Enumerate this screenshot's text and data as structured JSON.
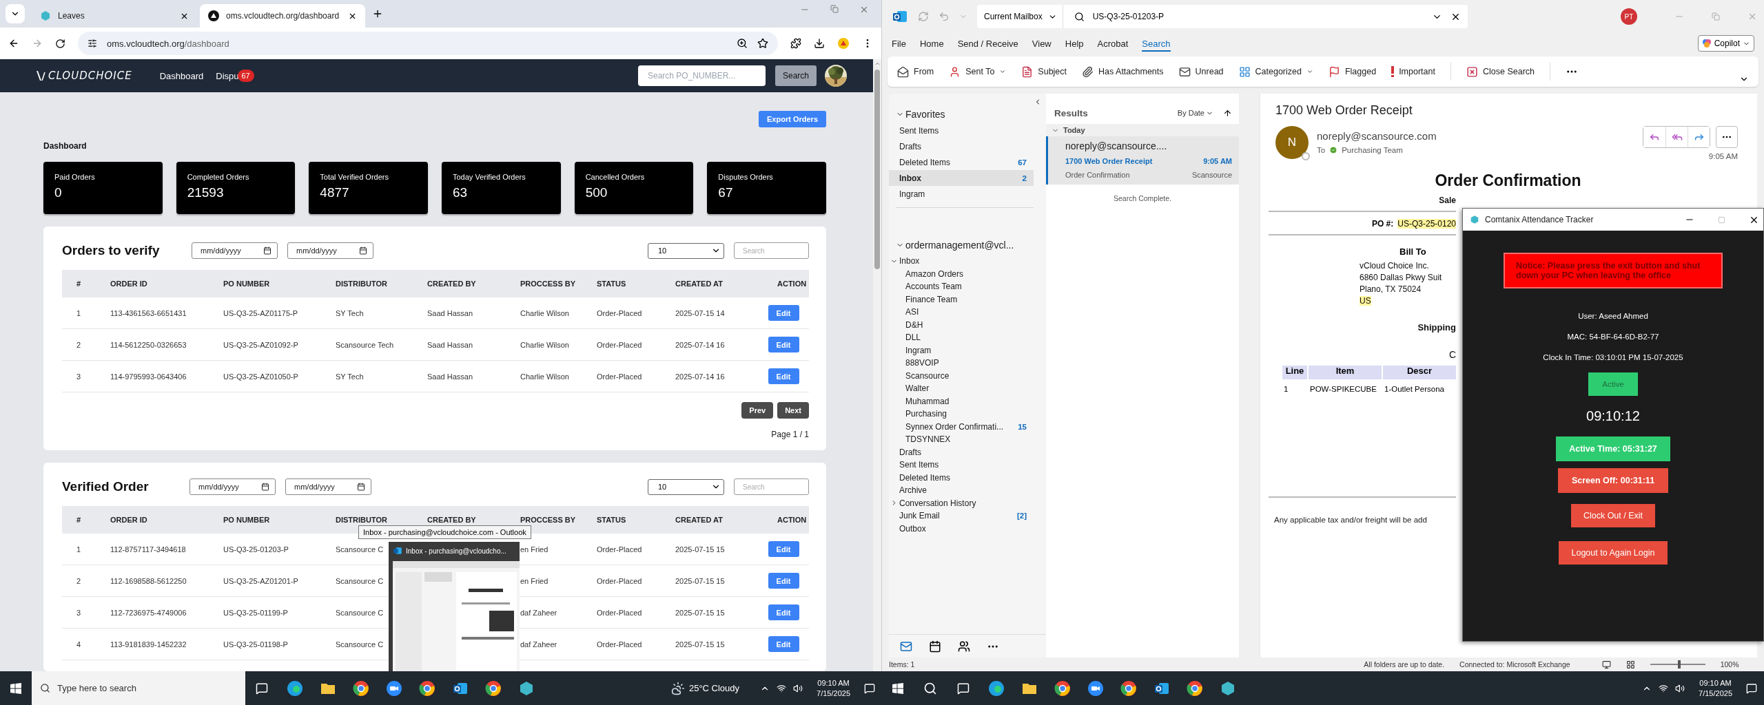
{
  "browser": {
    "tabs": [
      {
        "label": "Leaves",
        "selected": false
      },
      {
        "label": "oms.vcloudtech.org/dashboard",
        "selected": true
      }
    ],
    "address": {
      "host": "oms.vcloudtech.org",
      "path": "/dashboard"
    }
  },
  "site": {
    "logo": "CLOUDCHOICE",
    "nav": [
      {
        "label": "Dashboard"
      },
      {
        "label": "Dispu",
        "badge": "67"
      }
    ],
    "search": {
      "placeholder": "Search PO_NUMBER..."
    },
    "search_button": "Search"
  },
  "dashboard": {
    "export_button": "Export Orders",
    "title": "Dashboard",
    "stats": [
      {
        "label": "Paid Orders",
        "value": "0"
      },
      {
        "label": "Completed Orders",
        "value": "21593"
      },
      {
        "label": "Total Verified Orders",
        "value": "4877"
      },
      {
        "label": "Today Verified Orders",
        "value": "63"
      },
      {
        "label": "Cancelled Orders",
        "value": "500"
      },
      {
        "label": "Disputes Orders",
        "value": "67"
      }
    ]
  },
  "tables": [
    {
      "title": "Orders to verify",
      "date_filters": [
        "mm/dd/yyyy",
        "mm/dd/yyyy"
      ],
      "page_size": "10",
      "search": {
        "placeholder": "Search"
      },
      "columns": [
        "#",
        "ORDER ID",
        "PO NUMBER",
        "DISTRIBUTOR",
        "CREATED BY",
        "PROCCESS BY",
        "STATUS",
        "CREATED AT",
        "ACTION"
      ],
      "rows": [
        {
          "num": "1",
          "order_id": "113-4361563-6651431",
          "po": "US-Q3-25-AZ01175-P",
          "distributor": "SY Tech",
          "created_by": "Saad Hassan",
          "process_by": "Charlie Wilson",
          "status": "Order-Placed",
          "created_at": "2025-07-15 14",
          "action": "Edit"
        },
        {
          "num": "2",
          "order_id": "114-5612250-0326653",
          "po": "US-Q3-25-AZ01092-P",
          "distributor": "Scansource Tech",
          "created_by": "Saad Hassan",
          "process_by": "Charlie Wilson",
          "status": "Order-Placed",
          "created_at": "2025-07-14 16",
          "action": "Edit"
        },
        {
          "num": "3",
          "order_id": "114-9795993-0643406",
          "po": "US-Q3-25-AZ01050-P",
          "distributor": "SY Tech",
          "created_by": "Saad Hassan",
          "process_by": "Charlie Wilson",
          "status": "Order-Placed",
          "created_at": "2025-07-14 16",
          "action": "Edit"
        }
      ],
      "pager": {
        "prev": "Prev",
        "next": "Next",
        "page": "Page 1 / 1"
      }
    },
    {
      "title": "Verified Order",
      "date_filters": [
        "mm/dd/yyyy",
        "mm/dd/yyyy"
      ],
      "page_size": "10",
      "search": {
        "placeholder": "Search"
      },
      "columns": [
        "#",
        "ORDER ID",
        "PO NUMBER",
        "DISTRIBUTOR",
        "CREATED BY",
        "PROCCESS BY",
        "STATUS",
        "CREATED AT",
        "ACTION"
      ],
      "rows": [
        {
          "num": "1",
          "order_id": "112-8757117-3494618",
          "po": "US-Q3-25-01203-P",
          "distributor": "Scansource C",
          "process_by": "en Fried",
          "status": "Order-Placed",
          "created_at": "2025-07-15 15",
          "action": "Edit"
        },
        {
          "num": "2",
          "order_id": "112-1698588-5612250",
          "po": "US-Q3-25-AZ01201-P",
          "distributor": "Scansource C",
          "process_by": "en Fried",
          "status": "Order-Placed",
          "created_at": "2025-07-15 15",
          "action": "Edit"
        },
        {
          "num": "3",
          "order_id": "112-7236975-4749006",
          "po": "US-Q3-25-01199-P",
          "distributor": "Scansource C",
          "process_by": "daf Zaheer",
          "status": "Order-Placed",
          "created_at": "2025-07-15 15",
          "action": "Edit"
        },
        {
          "num": "4",
          "order_id": "113-9181839-1452232",
          "po": "US-Q3-25-01198-P",
          "distributor": "Scansource C",
          "process_by": "daf Zaheer",
          "status": "Order-Placed",
          "created_at": "2025-07-15 15",
          "action": "Edit"
        }
      ]
    }
  ],
  "task_preview": {
    "tooltip": "Inbox - purchasing@vcloudchoice.com - Outlook",
    "title": "Inbox - purchasing@vcloudcho..."
  },
  "outlook": {
    "scope": "Current Mailbox",
    "search_value": "US-Q3-25-01203-P",
    "account_initials": "PT",
    "menu": [
      {
        "label": "File",
        "selected": false
      },
      {
        "label": "Home",
        "selected": false
      },
      {
        "label": "Send / Receive",
        "selected": false
      },
      {
        "label": "View",
        "selected": false
      },
      {
        "label": "Help",
        "selected": false
      },
      {
        "label": "Acrobat",
        "selected": false
      },
      {
        "label": "Search",
        "selected": true
      }
    ],
    "copilot": "Copilot",
    "ribbon": [
      {
        "label": "From"
      },
      {
        "label": "Sent To",
        "dropdown": true
      },
      {
        "label": "Subject"
      },
      {
        "label": "Has Attachments"
      },
      {
        "label": "Unread"
      },
      {
        "label": "Categorized",
        "dropdown": true
      },
      {
        "label": "Flagged"
      },
      {
        "label": "Important"
      },
      {
        "label": "Close Search"
      }
    ],
    "favorites": {
      "label": "Favorites",
      "expanded": true,
      "items": [
        {
          "label": "Sent Items",
          "selected": false
        },
        {
          "label": "Drafts",
          "selected": false
        },
        {
          "label": "Deleted Items",
          "count": "67",
          "selected": false
        },
        {
          "label": "Inbox",
          "count": "2",
          "selected": true
        },
        {
          "label": "Ingram",
          "selected": false
        }
      ]
    },
    "account": {
      "label": "ordermanagement@vcl...",
      "expanded": true,
      "children": [
        {
          "label": "Inbox",
          "expanded": true,
          "children": [
            {
              "label": "Amazon Orders"
            },
            {
              "label": "Accounts Team"
            },
            {
              "label": "Finance Team"
            },
            {
              "label": "ASI"
            },
            {
              "label": "D&H"
            },
            {
              "label": "DLL"
            },
            {
              "label": "Ingram"
            },
            {
              "label": "888VOIP"
            },
            {
              "label": "Scansource"
            },
            {
              "label": "Walter"
            },
            {
              "label": "Muhammad"
            },
            {
              "label": "Purchasing"
            },
            {
              "label": "Synnex Order Confirmati...",
              "count": "15"
            },
            {
              "label": "TDSYNNEX"
            }
          ]
        },
        {
          "label": "Drafts"
        },
        {
          "label": "Sent Items"
        },
        {
          "label": "Deleted Items"
        },
        {
          "label": "Archive"
        },
        {
          "label": "Conversation History",
          "expanded": false
        },
        {
          "label": "Junk Email",
          "count": "[2]"
        },
        {
          "label": "Outbox"
        }
      ]
    },
    "results": {
      "title": "Results",
      "sort": "By Date",
      "group": "Today",
      "messages": [
        {
          "sender": "noreply@scansource....",
          "subject": "1700 Web Order Receipt",
          "time": "9:05 AM",
          "preview": "Order Confirmation",
          "folder": "Scansource",
          "selected": true
        }
      ],
      "status": "Search Complete."
    },
    "reading": {
      "subject": "1700 Web Order Receipt",
      "avatar_initial": "N",
      "from": "noreply@scansource.com",
      "to_label": "To",
      "to": "Purchasing Team",
      "time": "9:05 AM",
      "heading": "Order Confirmation",
      "sale": "Sale",
      "po_label": "PO #:",
      "po_value": "US-Q3-25-0120",
      "bill_to": "Bill To",
      "address": [
        "vCloud Choice Inc.",
        "6860 Dallas Pkwy Suit",
        "Plano, TX 75024",
        "US"
      ],
      "shipping": "Shipping",
      "c": "C",
      "items_columns": [
        "Line",
        "Item",
        "Descr"
      ],
      "items_row": [
        "1",
        "POW-SPIKECUBE",
        "1-Outlet Persona"
      ],
      "footer": "Any applicable tax and/or freight will be add"
    },
    "status": {
      "items": "Items: 1",
      "sync": "All folders are up to date.",
      "connection": "Connected to: Microsoft Exchange",
      "zoom": "100%",
      "zoom_slider": {
        "level": 0.55
      }
    }
  },
  "tracker": {
    "title": "Comtanix Attendance Tracker",
    "notice": "Notice: Please press the exit button and shut down your PC when leaving the office",
    "user": "User: Aseed Ahmed",
    "mac": "MAC: 54-BF-64-6D-B2-77",
    "clock_in": "Clock In Time: 03:10:01 PM 15-07-2025",
    "status_button": "Active",
    "clock": "09:10:12",
    "active_time": "Active Time: 05:31:27",
    "screen_off": "Screen Off: 00:31:11",
    "buttons": [
      "Clock Out / Exit",
      "Logout to Again Login"
    ]
  },
  "taskbars": [
    {
      "search_placeholder": "Type here to search",
      "weather": "25°C Cloudy",
      "time": "09:10 AM",
      "date": "7/15/2025"
    },
    {
      "time": "09:10 AM",
      "date": "7/15/2025"
    }
  ]
}
